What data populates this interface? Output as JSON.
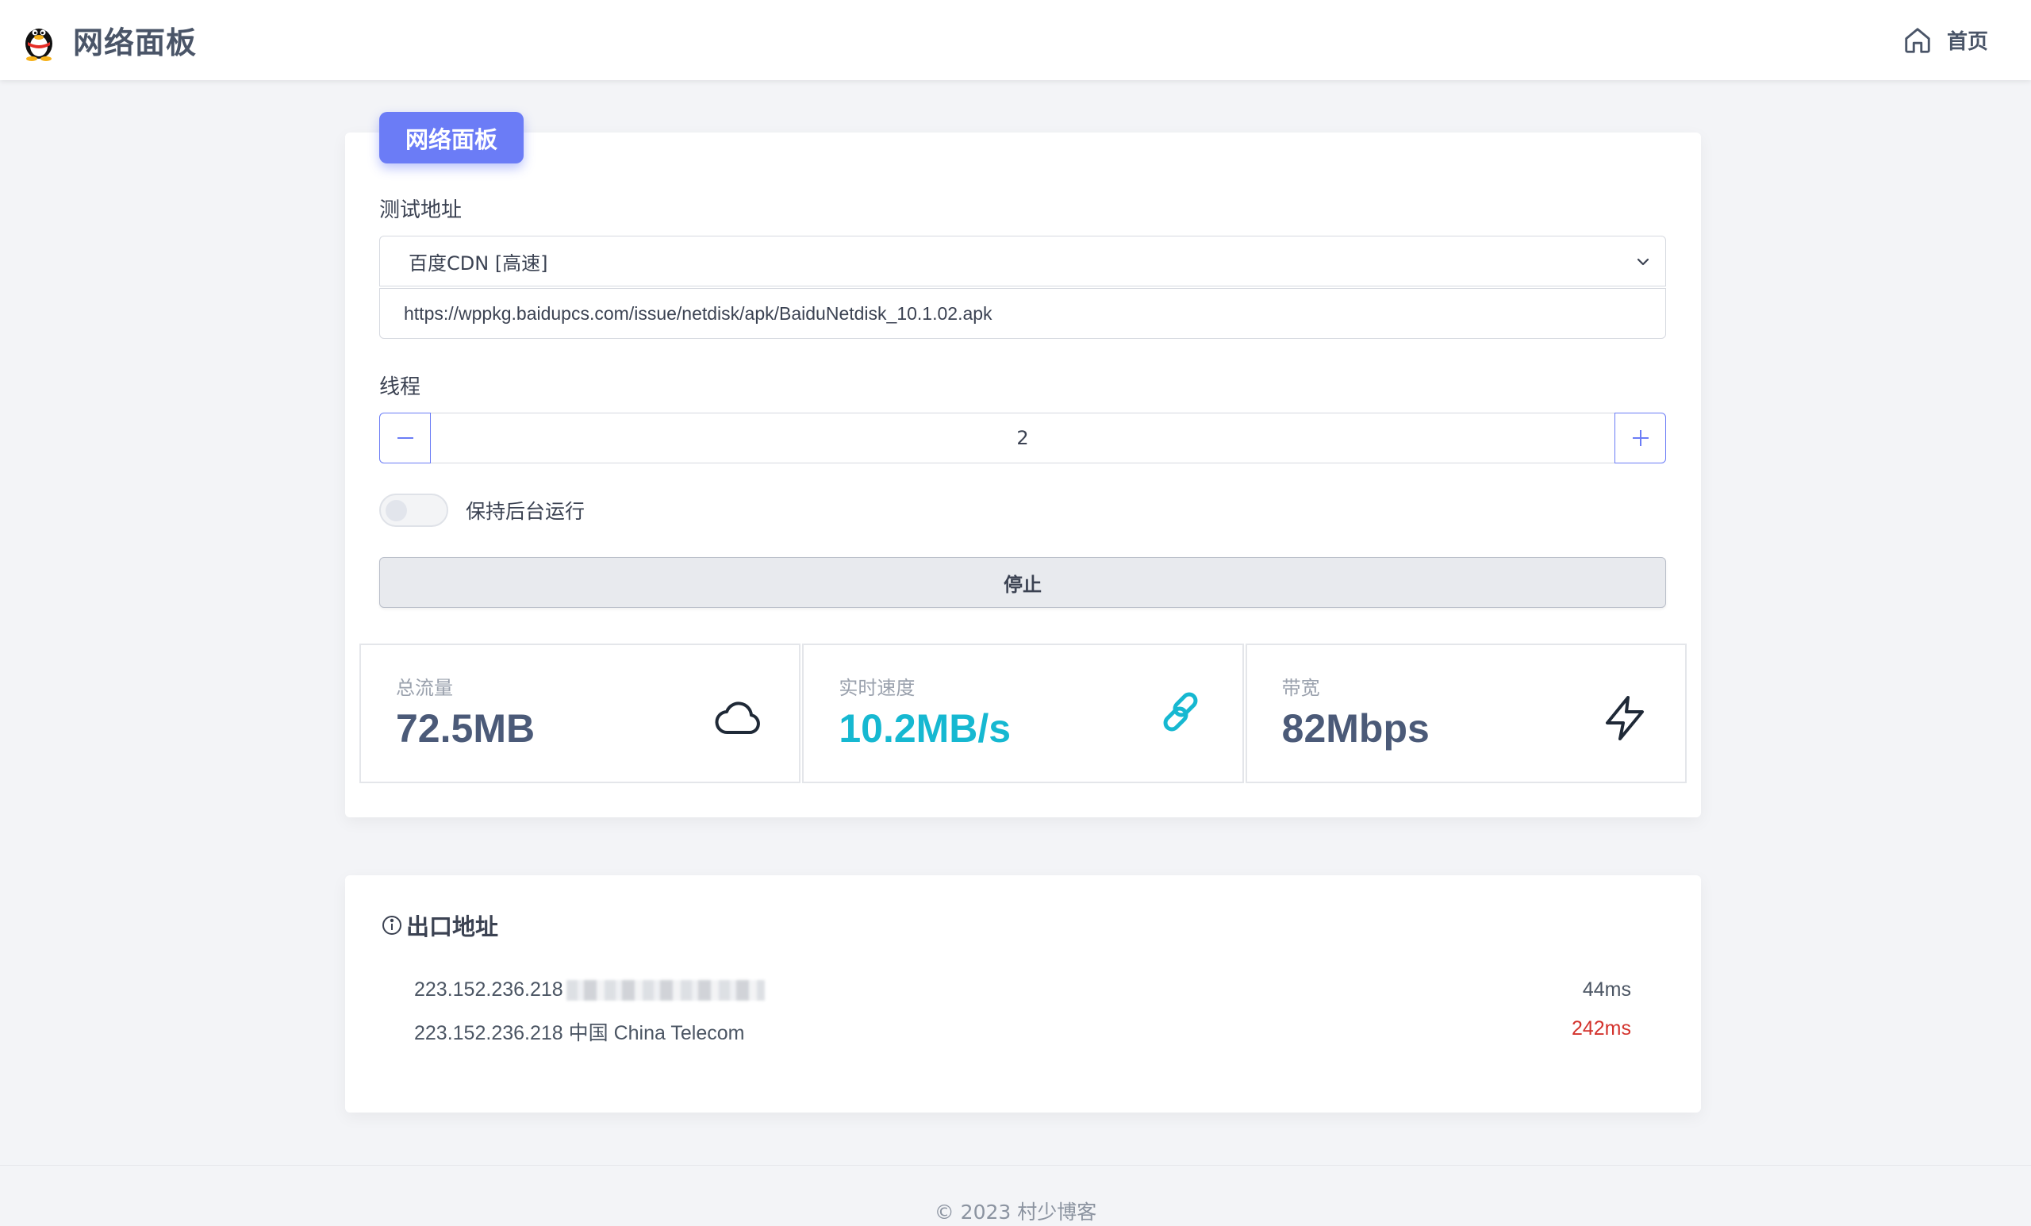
{
  "header": {
    "title": "网络面板",
    "home_label": "首页"
  },
  "panel": {
    "badge": "网络面板",
    "test_address_label": "测试地址",
    "selected_source": "百度CDN [高速]",
    "url": "https://wppkg.baidupcs.com/issue/netdisk/apk/BaiduNetdisk_10.1.02.apk",
    "threads_label": "线程",
    "threads_value": "2",
    "keep_background_label": "保持后台运行",
    "keep_background_on": false,
    "stop_label": "停止"
  },
  "stats": [
    {
      "label": "总流量",
      "value": "72.5MB",
      "icon": "cloud-icon"
    },
    {
      "label": "实时速度",
      "value": "10.2MB/s",
      "icon": "link-icon"
    },
    {
      "label": "带宽",
      "value": "82Mbps",
      "icon": "lightning-icon"
    }
  ],
  "exit": {
    "title": "出口地址",
    "rows": [
      {
        "ip": "223.152.236.218",
        "location": "",
        "latency": "44ms"
      },
      {
        "ip": "223.152.236.218",
        "location": "中国 China Telecom",
        "latency": "242ms"
      }
    ]
  },
  "footer": "© 2023 村少博客",
  "colors": {
    "accent": "#6b7cf6",
    "speed": "#16b8d1",
    "latency_warn": "#d3322c"
  }
}
